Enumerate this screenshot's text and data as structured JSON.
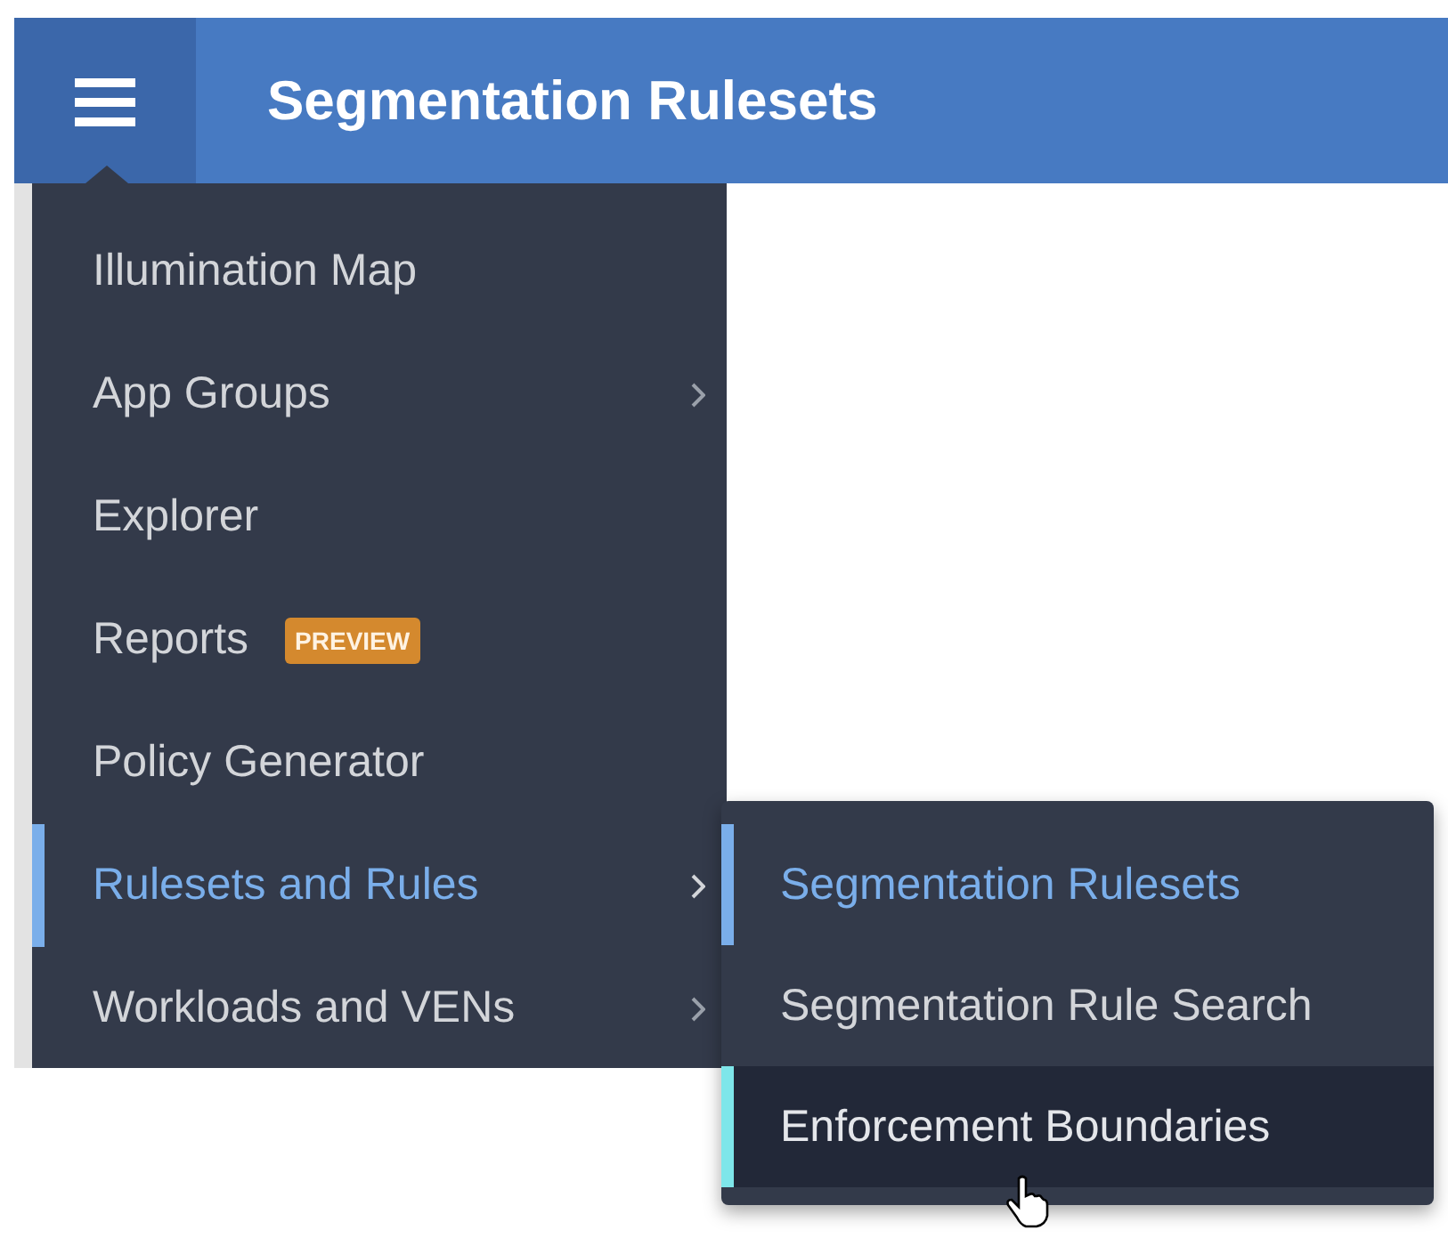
{
  "header": {
    "title": "Segmentation Rulesets"
  },
  "menu": {
    "items": [
      {
        "label": "Illumination Map",
        "selected": false,
        "has_submenu": false
      },
      {
        "label": "App Groups",
        "selected": false,
        "has_submenu": true
      },
      {
        "label": "Explorer",
        "selected": false,
        "has_submenu": false
      },
      {
        "label": "Reports",
        "selected": false,
        "has_submenu": false,
        "badge": "PREVIEW"
      },
      {
        "label": "Policy Generator",
        "selected": false,
        "has_submenu": false
      },
      {
        "label": "Rulesets and Rules",
        "selected": true,
        "has_submenu": true
      },
      {
        "label": "Workloads and VENs",
        "selected": false,
        "has_submenu": true
      }
    ]
  },
  "submenu": {
    "items": [
      {
        "label": "Segmentation Rulesets",
        "selected": true,
        "hovered": false
      },
      {
        "label": "Segmentation Rule Search",
        "selected": false,
        "hovered": false
      },
      {
        "label": "Enforcement Boundaries",
        "selected": false,
        "hovered": true
      }
    ]
  }
}
